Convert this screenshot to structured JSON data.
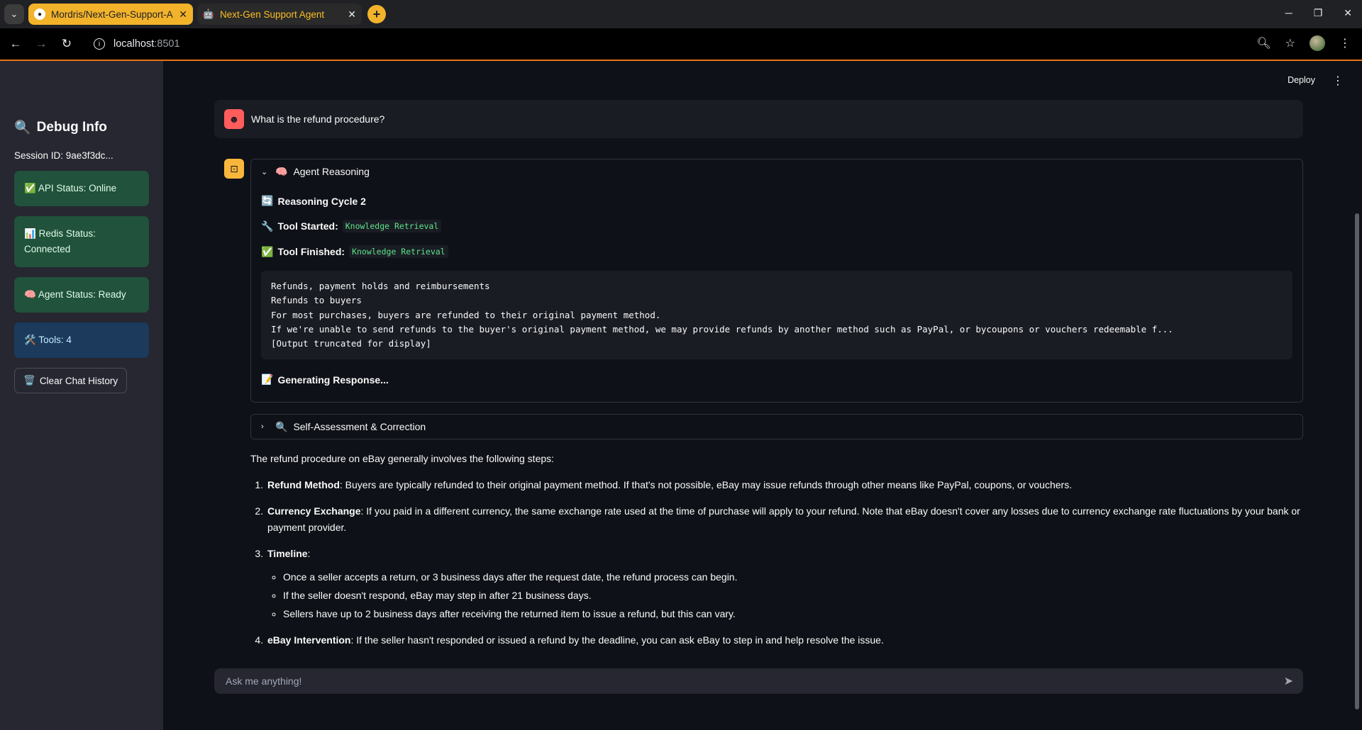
{
  "browser": {
    "tabs": [
      {
        "title": "Mordris/Next-Gen-Support-A",
        "icon": "github-icon",
        "active": false
      },
      {
        "title": "Next-Gen Support Agent",
        "icon": "robot-icon",
        "active": true
      }
    ],
    "url_host": "localhost",
    "url_port": ":8501"
  },
  "sidebar": {
    "title": "Debug Info",
    "session": "Session ID: 9ae3f3dc...",
    "statuses": [
      {
        "emoji": "✅",
        "text": "API Status: Online",
        "color": "green"
      },
      {
        "emoji": "📊",
        "text": "Redis Status: Connected",
        "color": "green"
      },
      {
        "emoji": "🧠",
        "text": "Agent Status: Ready",
        "color": "green"
      },
      {
        "emoji": "🛠️",
        "text": "Tools: 4",
        "color": "blue"
      }
    ],
    "clear_button": "Clear Chat History"
  },
  "header": {
    "deploy": "Deploy"
  },
  "chat": {
    "user_message": "What is the refund procedure?",
    "reasoning": {
      "title": "Agent Reasoning",
      "cycle": "Reasoning Cycle 2",
      "tool_started_label": "Tool Started:",
      "tool_started": "Knowledge Retrieval",
      "tool_finished_label": "Tool Finished:",
      "tool_finished": "Knowledge Retrieval",
      "output_lines": [
        "Refunds, payment holds and reimbursements",
        "Refunds to buyers",
        "For most purchases, buyers are refunded to their original payment method.",
        "If we're unable to send refunds to the buyer's original payment method, we may provide refunds by another method such as PayPal, or bycoupons or vouchers redeemable f...",
        "[Output truncated for display]"
      ],
      "generating": "Generating Response..."
    },
    "self_assessment": "Self-Assessment & Correction",
    "answer": {
      "intro": "The refund procedure on eBay generally involves the following steps:",
      "step1_title": "Refund Method",
      "step1_text": ": Buyers are typically refunded to their original payment method. If that's not possible, eBay may issue refunds through other means like PayPal, coupons, or vouchers.",
      "step2_title": "Currency Exchange",
      "step2_text": ": If you paid in a different currency, the same exchange rate used at the time of purchase will apply to your refund. Note that eBay doesn't cover any losses due to currency exchange rate fluctuations by your bank or payment provider.",
      "step3_title": "Timeline",
      "step3_text": ":",
      "step3_subs": [
        "Once a seller accepts a return, or 3 business days after the request date, the refund process can begin.",
        "If the seller doesn't respond, eBay may step in after 21 business days.",
        "Sellers have up to 2 business days after receiving the returned item to issue a refund, but this can vary."
      ],
      "step4_title": "eBay Intervention",
      "step4_text": ": If the seller hasn't responded or issued a refund by the deadline, you can ask eBay to step in and help resolve the issue."
    },
    "input_placeholder": "Ask me anything!"
  }
}
